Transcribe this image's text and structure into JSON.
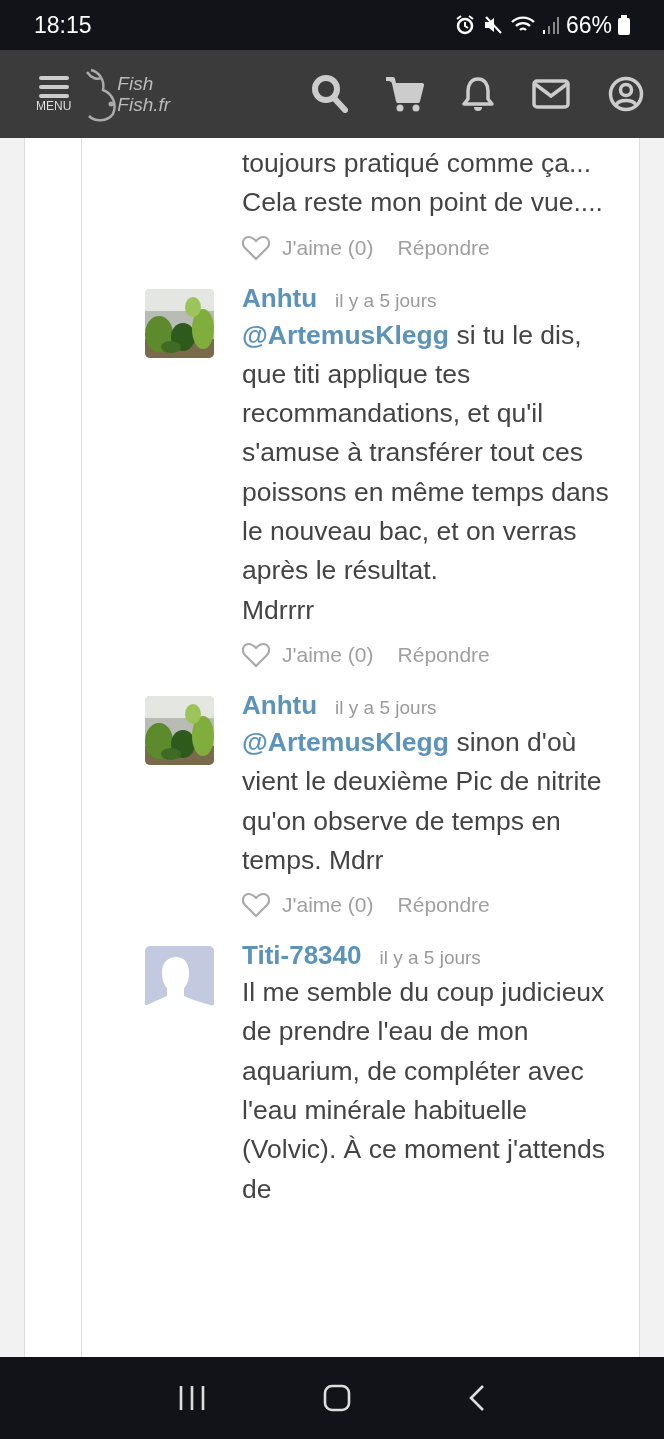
{
  "status_bar": {
    "time": "18:15",
    "battery": "66%"
  },
  "header": {
    "menu_label": "MENU",
    "logo": [
      "Fish",
      "Fish.fr"
    ]
  },
  "comments": [
    {
      "text": "toujours pratiqué comme ça... Cela reste mon point de vue....",
      "like": "J'aime (0)",
      "reply": "Répondre"
    },
    {
      "name": "Anhtu",
      "time": "il y a 5 jours",
      "mention": "@ArtemusKlegg",
      "text": "si tu le dis, que titi applique tes recommandations, et qu'il s'amuse à transférer tout ces poissons en même temps dans le nouveau bac, et on verras après le résultat.\nMdrrrr",
      "like": "J'aime (0)",
      "reply": "Répondre"
    },
    {
      "name": "Anhtu",
      "time": "il y a 5 jours",
      "mention": "@ArtemusKlegg",
      "text": "sinon d'où vient le deuxième Pic de nitrite qu'on observe de temps en temps. Mdrr",
      "like": "J'aime (0)",
      "reply": "Répondre"
    },
    {
      "avatar": {
        "kind": "default"
      },
      "name": "Titi-78340",
      "time": "il y a 5 jours",
      "text": "Il me semble du coup judicieux de prendre l'eau de mon aquarium, de compléter avec l'eau minérale habituelle (Volvic). À ce moment j'attends de"
    }
  ]
}
